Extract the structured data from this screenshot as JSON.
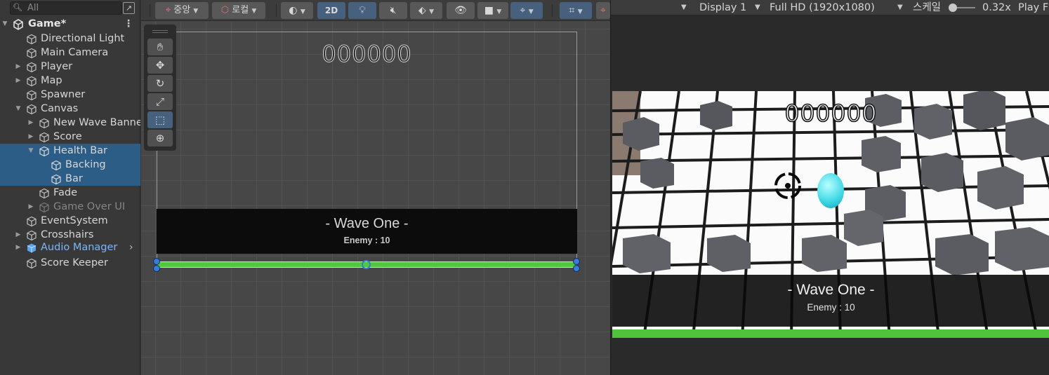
{
  "hierarchy": {
    "search_placeholder": "All",
    "items": [
      {
        "label": "Game*",
        "kind": "scene"
      },
      {
        "label": "Directional Light"
      },
      {
        "label": "Main Camera"
      },
      {
        "label": "Player"
      },
      {
        "label": "Map"
      },
      {
        "label": "Spawner"
      },
      {
        "label": "Canvas"
      },
      {
        "label": "New Wave Banner"
      },
      {
        "label": "Score"
      },
      {
        "label": "Health Bar",
        "selected": true
      },
      {
        "label": "Backing",
        "selected": true
      },
      {
        "label": "Bar",
        "selected": true
      },
      {
        "label": "Fade"
      },
      {
        "label": "Game Over UI",
        "inactive": true
      },
      {
        "label": "EventSystem"
      },
      {
        "label": "Crosshairs"
      },
      {
        "label": "Audio Manager",
        "prefab": true
      },
      {
        "label": "Score Keeper"
      }
    ]
  },
  "scene_toolbar": {
    "pivot_label": "중앙",
    "space_label": "로컬",
    "mode_2d": "2D"
  },
  "scene": {
    "score_text": "000000",
    "banner_title": "- Wave One -",
    "banner_sub": "Enemy : 10"
  },
  "game_toolbar": {
    "display": "Display 1",
    "resolution": "Full HD (1920x1080)",
    "scale_label": "스케일",
    "scale_value": "0.32x",
    "play_label": "Play F"
  },
  "game": {
    "score_text": "000000",
    "banner_title": "- Wave One -",
    "banner_sub": "Enemy : 10",
    "health_fraction": 1.0
  },
  "colors": {
    "selection": "#2c5d87",
    "health_bar": "#4fc33b",
    "prefab_text": "#7cb6f3",
    "toggle_on": "#46607e"
  }
}
